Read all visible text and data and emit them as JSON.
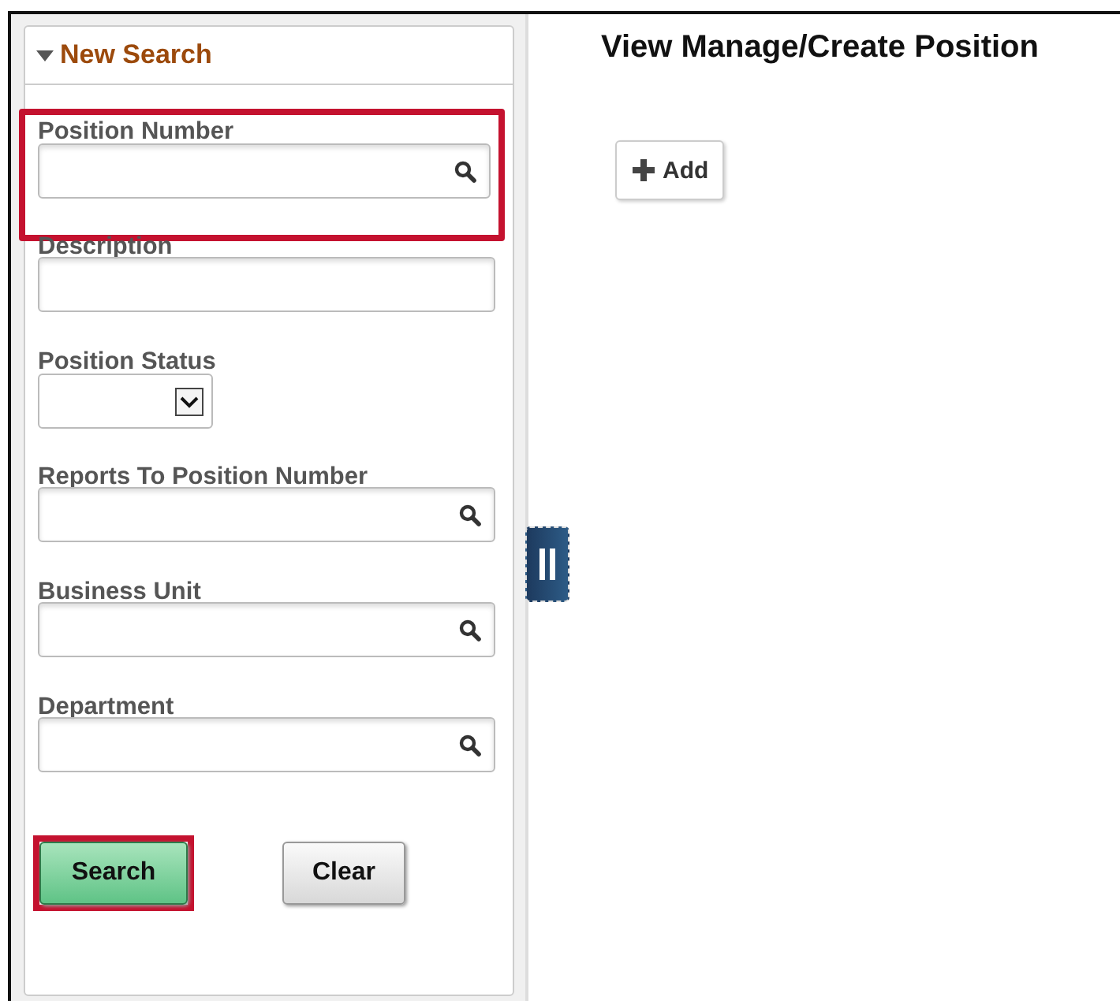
{
  "search_panel": {
    "title": "New Search",
    "expanded": true,
    "fields": [
      {
        "label": "Position Number",
        "kind": "lookup",
        "highlighted": true
      },
      {
        "label": "Description",
        "kind": "text",
        "highlighted": false
      },
      {
        "label": "Position Status",
        "kind": "dropdown",
        "highlighted": false
      },
      {
        "label": "Reports To Position Number",
        "kind": "lookup",
        "highlighted": false
      },
      {
        "label": "Business Unit",
        "kind": "lookup",
        "highlighted": false
      },
      {
        "label": "Department",
        "kind": "lookup",
        "highlighted": false
      }
    ],
    "buttons": [
      {
        "label": "Search",
        "kind": "primary",
        "highlighted": true
      },
      {
        "label": "Clear",
        "kind": "secondary",
        "highlighted": false
      }
    ]
  },
  "main": {
    "title": "View Manage/Create Position",
    "add_button": "Add"
  }
}
